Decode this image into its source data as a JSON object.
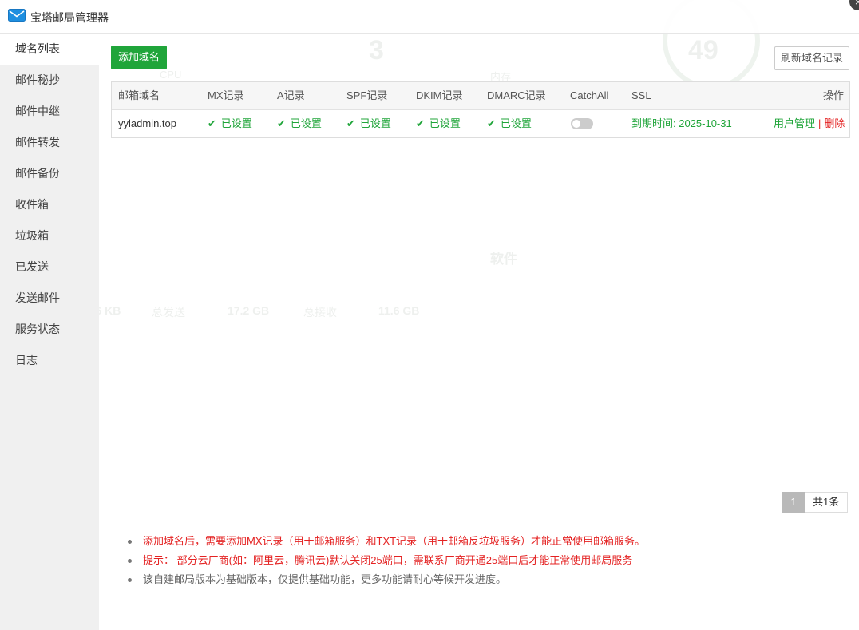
{
  "window": {
    "title": "宝塔邮局管理器",
    "close_glyph": "×"
  },
  "sidebar": {
    "items": [
      {
        "label": "域名列表",
        "active": true
      },
      {
        "label": "邮件秘抄"
      },
      {
        "label": "邮件中继"
      },
      {
        "label": "邮件转发"
      },
      {
        "label": "邮件备份"
      },
      {
        "label": "收件箱"
      },
      {
        "label": "垃圾箱"
      },
      {
        "label": "已发送"
      },
      {
        "label": "发送邮件"
      },
      {
        "label": "服务状态"
      },
      {
        "label": "日志"
      }
    ]
  },
  "toolbar": {
    "add_domain_label": "添加域名",
    "refresh_label": "刷新域名记录"
  },
  "table": {
    "headers": [
      "邮箱域名",
      "MX记录",
      "A记录",
      "SPF记录",
      "DKIM记录",
      "DMARC记录",
      "CatchAll",
      "SSL",
      "操作"
    ],
    "rows": [
      {
        "domain": "yyladmin.top",
        "mx": "已设置",
        "a": "已设置",
        "spf": "已设置",
        "dkim": "已设置",
        "dmarc": "已设置",
        "catchall_enabled": false,
        "ssl": "到期时间: 2025-10-31",
        "action_users": "用户管理",
        "action_separator": "|",
        "action_delete": "删除"
      }
    ]
  },
  "pagination": {
    "current": "1",
    "total": "共1条"
  },
  "notes": [
    {
      "text": "添加域名后，需要添加MX记录（用于邮箱服务）和TXT记录（用于邮箱反垃圾服务）才能正常使用邮箱服务。",
      "color": "#e42222"
    },
    {
      "text": "提示： 部分云厂商(如：阿里云，腾讯云)默认关闭25端口，需联系厂商开通25端口后才能正常使用邮局服务",
      "color": "#e42222"
    },
    {
      "text": "该自建邮局版本为基础版本，仅提供基础功能，更多功能请耐心等候开发进度。",
      "color": "#666666"
    }
  ],
  "background_ghost": {
    "cpu_value": "3",
    "cpu_label": "CPU",
    "cpu_cores": "2核心",
    "mem_value": "49",
    "mem_label": "内存",
    "software_title": "软件",
    "traffic_left": "10.6 KB",
    "traffic_sent": "总发送",
    "disk_total": "17.2 GB",
    "disk_label": "总接收",
    "disk_used": "11.6 GB"
  },
  "colors": {
    "accent": "#20a53a",
    "danger": "#e42222",
    "sidebar_bg": "#f0f0f0"
  }
}
